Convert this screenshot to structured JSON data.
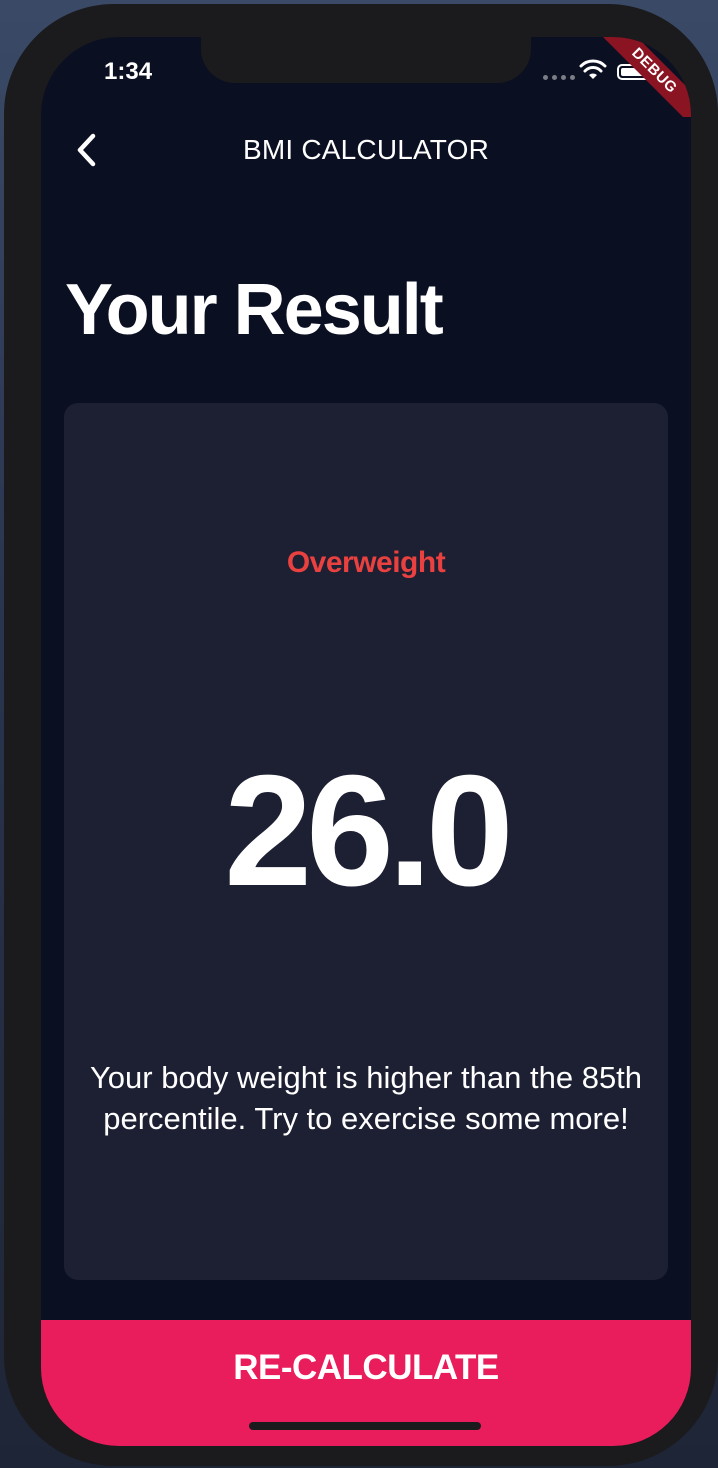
{
  "status_bar": {
    "time": "1:34",
    "debug_label": "DEBUG"
  },
  "app_bar": {
    "title": "BMI CALCULATOR",
    "back_icon": "chevron-left-icon"
  },
  "page": {
    "title": "Your Result"
  },
  "result": {
    "category": "Overweight",
    "bmi": "26.0",
    "interpretation": "Your body weight is higher than the 85th percentile. Try to exercise some more!"
  },
  "actions": {
    "recalculate_label": "RE-CALCULATE"
  },
  "colors": {
    "background": "#0b0f22",
    "card": "#1d1f33",
    "accent": "#e91d5b",
    "category_text": "#e9413f"
  }
}
